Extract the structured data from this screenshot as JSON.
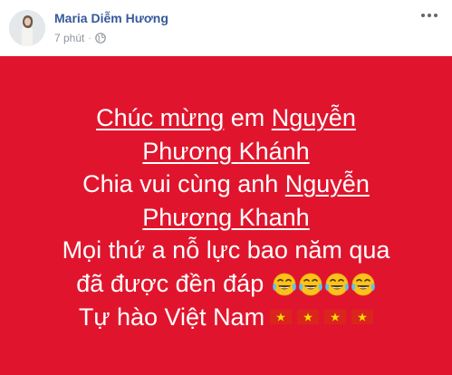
{
  "post": {
    "author": "Maria Diễm Hương",
    "time": "7 phút",
    "separator": "·",
    "privacy_icon": "globe-icon",
    "more_icon": "ellipsis-icon"
  },
  "banner": {
    "background": "#e0152d",
    "text_color": "#ffffff",
    "line1_a": "Chúc mừng",
    "line1_b": " em ",
    "line1_c": "Nguyễn",
    "line2": "Phương Khánh",
    "line3_a": "Chia vui cùng anh ",
    "line3_b": "Nguyễn",
    "line4": "Phương Khanh",
    "line5": "Mọi thứ a nỗ lực bao năm qua",
    "line6": "đã được đền đáp ",
    "line7": "Tự hào Việt Nam",
    "emoji_icon": "tears-of-joy-emoji",
    "emoji_count": 4,
    "flag_icon": "vietnam-flag-icon",
    "flag_count": 4
  }
}
